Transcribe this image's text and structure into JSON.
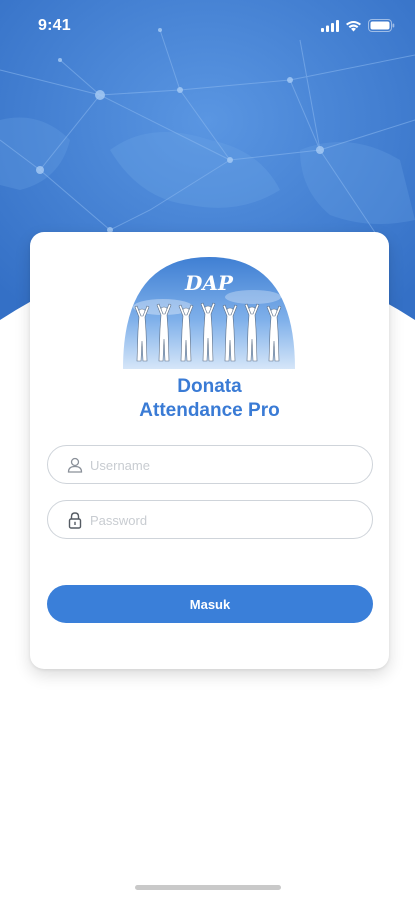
{
  "status_bar": {
    "time": "9:41"
  },
  "logo": {
    "text": "DAP"
  },
  "app": {
    "title_line1": "Donata",
    "title_line2": "Attendance Pro"
  },
  "form": {
    "username_placeholder": "Username",
    "password_placeholder": "Password",
    "submit_label": "Masuk"
  },
  "colors": {
    "primary": "#3a7fd9",
    "hero": "#3f7fd3",
    "title": "#3a7bd5"
  }
}
